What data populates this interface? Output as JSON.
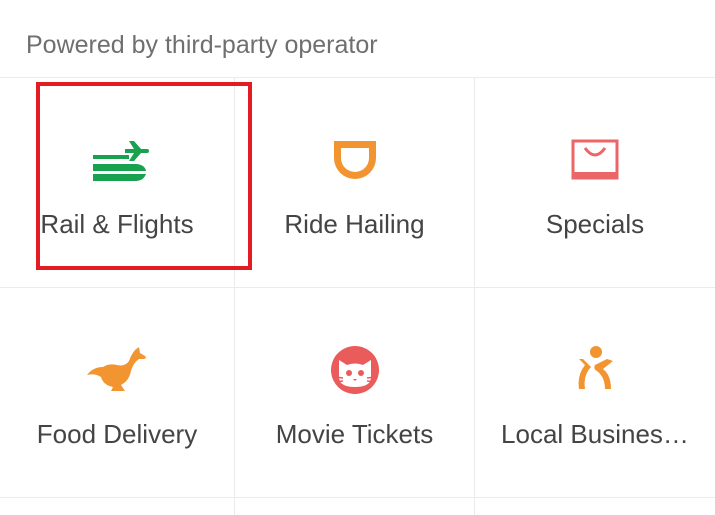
{
  "header": {
    "text": "Powered by third-party operator"
  },
  "services": [
    {
      "label": "Rail & Flights",
      "icon": "train-plane-icon",
      "color": "#1aa14f"
    },
    {
      "label": "Ride Hailing",
      "icon": "ride-hailing-d-icon",
      "color": "#f29430"
    },
    {
      "label": "Specials",
      "icon": "shopping-bag-icon",
      "color": "#eb6666"
    },
    {
      "label": "Food Delivery",
      "icon": "kangaroo-icon",
      "color": "#f29430"
    },
    {
      "label": "Movie Tickets",
      "icon": "cat-face-icon",
      "color": "#ea5c5c"
    },
    {
      "label": "Local Busines…",
      "icon": "person-icon",
      "color": "#f29430"
    }
  ],
  "highlight_color": "#e31b23"
}
